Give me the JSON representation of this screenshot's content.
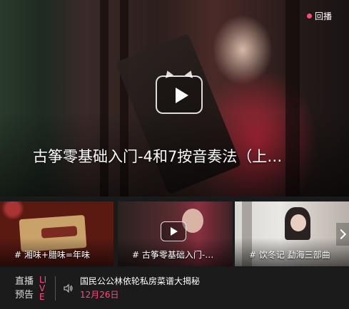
{
  "hero": {
    "badge": "回播",
    "title": "古筝零基础入门-4和7按音奏法（上…",
    "play_icon": "play-icon",
    "badge_color": "#ff4a7d"
  },
  "thumbnails": [
    {
      "caption": "# 湘味+腊味=年味"
    },
    {
      "caption": "# 古筝零基础入门-…"
    },
    {
      "caption": "# 饮冬记 勐海三部曲"
    }
  ],
  "next_icon": "chevron-right-icon",
  "livebar": {
    "label_line1": "直播",
    "label_line2": "预告",
    "live_text": "LIVE",
    "speaker_icon": "speaker-icon",
    "title": "国民公公林依轮私房菜谱大揭秘",
    "date": "12月26日",
    "accent_color": "#ff4a7d"
  }
}
